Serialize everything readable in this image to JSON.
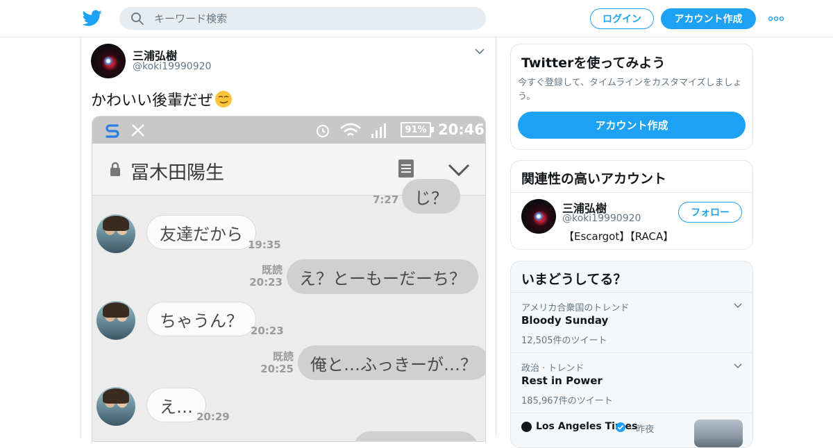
{
  "header": {
    "search_placeholder": "キーワード検索",
    "login_label": "ログイン",
    "signup_label": "アカウント作成"
  },
  "tweet": {
    "display_name": "三浦弘樹",
    "handle": "@koki19990920",
    "text": "かわいい後輩だぜ",
    "screenshot": {
      "status_battery": "91%",
      "status_time": "20:46",
      "chat_title": "冨木田陽生",
      "messages": [
        {
          "side": "out",
          "text": "じ？",
          "time": "7:27"
        },
        {
          "side": "in",
          "text": "友達だから",
          "time": "19:35"
        },
        {
          "side": "out",
          "text": "え？とーもーだーち？",
          "read": "既読",
          "time": "20:23"
        },
        {
          "side": "in",
          "text": "ちゃうん？",
          "time": "20:23"
        },
        {
          "side": "out",
          "text": "俺と…ふっきーが…？",
          "read": "既読",
          "time": "20:25"
        },
        {
          "side": "in",
          "text": "え…",
          "time": "20:29"
        }
      ]
    }
  },
  "sidebar": {
    "signup_card": {
      "title": "Twitterを使ってみよう",
      "desc": "今すぐ登録して、タイムラインをカスタマイズしましょう。",
      "cta": "アカウント作成"
    },
    "related": {
      "title": "関連性の高いアカウント",
      "name": "三浦弘樹",
      "handle": "@koki19990920",
      "bio": "【Escargot】【RACA】",
      "follow_label": "フォロー"
    },
    "trends": {
      "title": "いまどうしてる？",
      "items": [
        {
          "category": "アメリカ合衆国のトレンド",
          "name": "Bloody Sunday",
          "count": "12,505件のツイート"
        },
        {
          "category": "政治 · トレンド",
          "name": "Rest in Power",
          "count": "185,967件のツイート"
        }
      ],
      "news": {
        "source": "Los Angeles Times",
        "time": "· 昨夜"
      }
    }
  },
  "colors": {
    "brand": "#1da1f2",
    "text": "#14171a",
    "muted": "#657786",
    "border": "#e1e8ed"
  }
}
